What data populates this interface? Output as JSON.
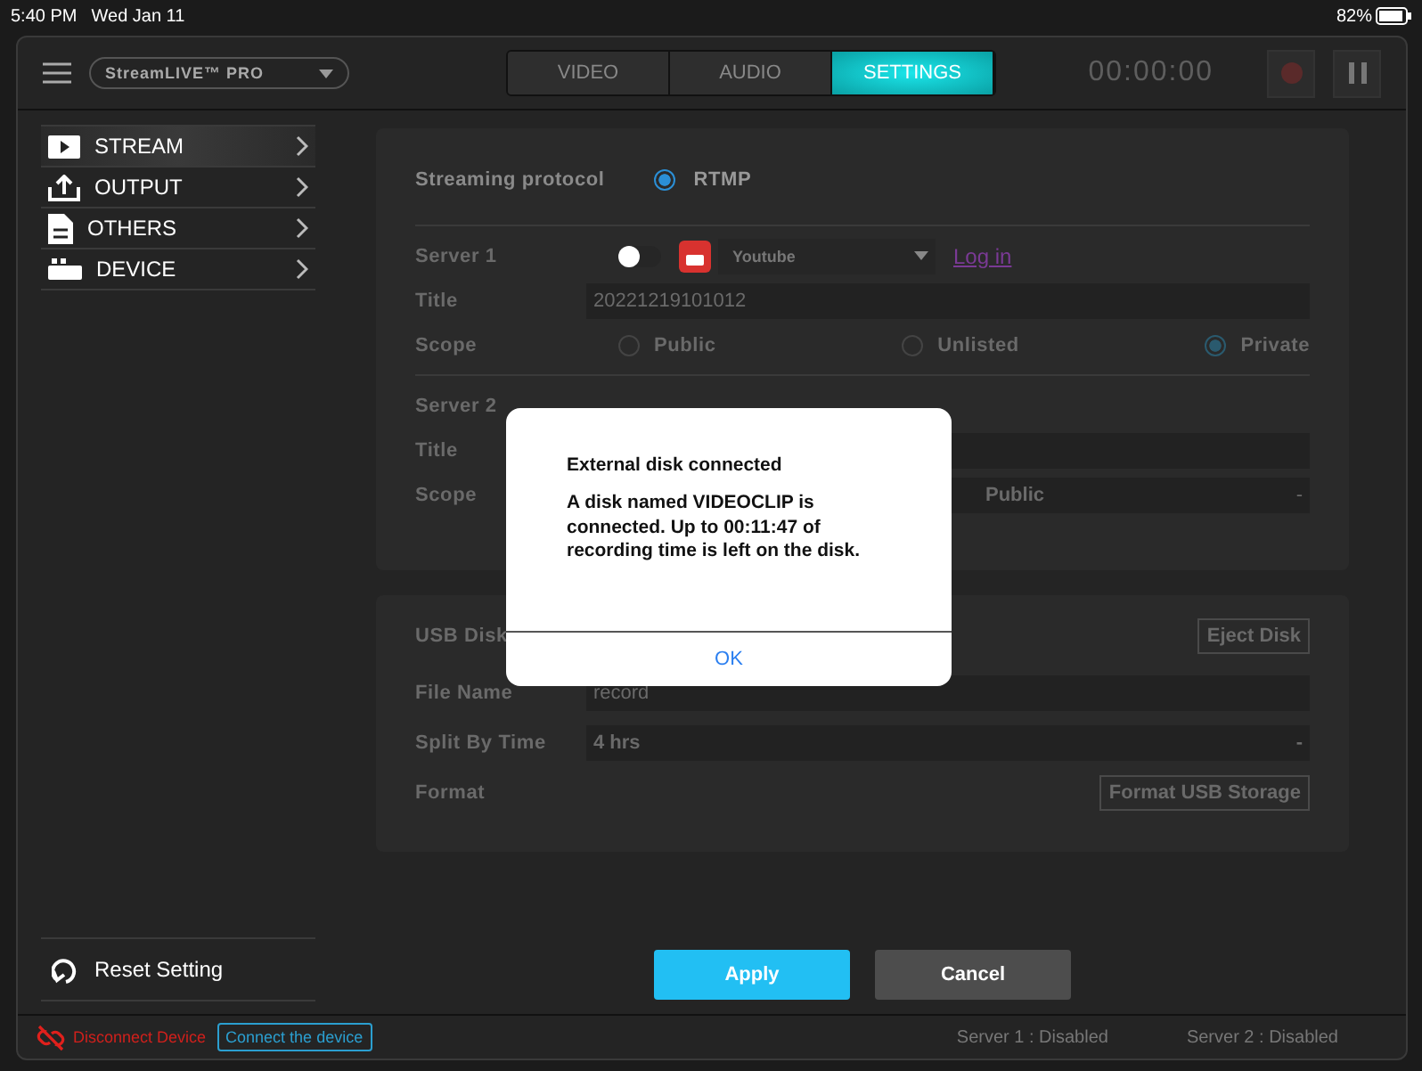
{
  "status_bar": {
    "time": "5:40 PM",
    "date": "Wed Jan 11",
    "battery": "82%"
  },
  "toolbar": {
    "device": "StreamLIVE™ PRO",
    "timer": "00:00:00"
  },
  "tabs": [
    {
      "label": "VIDEO",
      "selected": false
    },
    {
      "label": "AUDIO",
      "selected": false
    },
    {
      "label": "SETTINGS",
      "selected": true
    }
  ],
  "sidebar": {
    "items": [
      {
        "label": "STREAM",
        "kind": "stream",
        "selected": true
      },
      {
        "label": "OUTPUT",
        "kind": "output",
        "selected": false
      },
      {
        "label": "OTHERS",
        "kind": "others",
        "selected": false
      },
      {
        "label": "DEVICE",
        "kind": "device",
        "selected": false
      }
    ],
    "reset": "Reset Setting"
  },
  "stream_panel": {
    "protocol_label": "Streaming protocol",
    "protocol": "RTMP",
    "protocol_selected": true,
    "server1": {
      "label": "Server 1",
      "on": false,
      "platform": "Youtube",
      "login": "Log in",
      "title_label": "Title",
      "title": "20221219101012",
      "scope_label": "Scope",
      "scopes": [
        {
          "label": "Public",
          "selected": false
        },
        {
          "label": "Unlisted",
          "selected": false
        },
        {
          "label": "Private",
          "selected": true
        }
      ]
    },
    "server2": {
      "label": "Server 2",
      "title_label": "Title",
      "scope_label": "Scope",
      "scope": "Public",
      "scope_caret": "-"
    }
  },
  "usb_panel": {
    "disk_label": "USB Disk",
    "eject": "Eject Disk",
    "file_name_label": "File Name",
    "file_name": "record",
    "split_label": "Split By Time",
    "split": "4 hrs",
    "split_caret": "-",
    "format_label": "Format",
    "format_button": "Format USB Storage"
  },
  "buttons": [
    {
      "label": "Apply",
      "kind": "primary"
    },
    {
      "label": "Cancel",
      "kind": "secondary"
    }
  ],
  "footer": {
    "device_status": "Disconnect Device",
    "connect": "Connect the device",
    "server1": "Server 1 :  Disabled",
    "server2": "Server 2 :  Disabled"
  },
  "dialog": {
    "title": "External disk connected",
    "message": "A disk named VIDEOCLIP is connected. Up to 00:11:47 of recording time is left on the disk.",
    "ok": "OK"
  }
}
